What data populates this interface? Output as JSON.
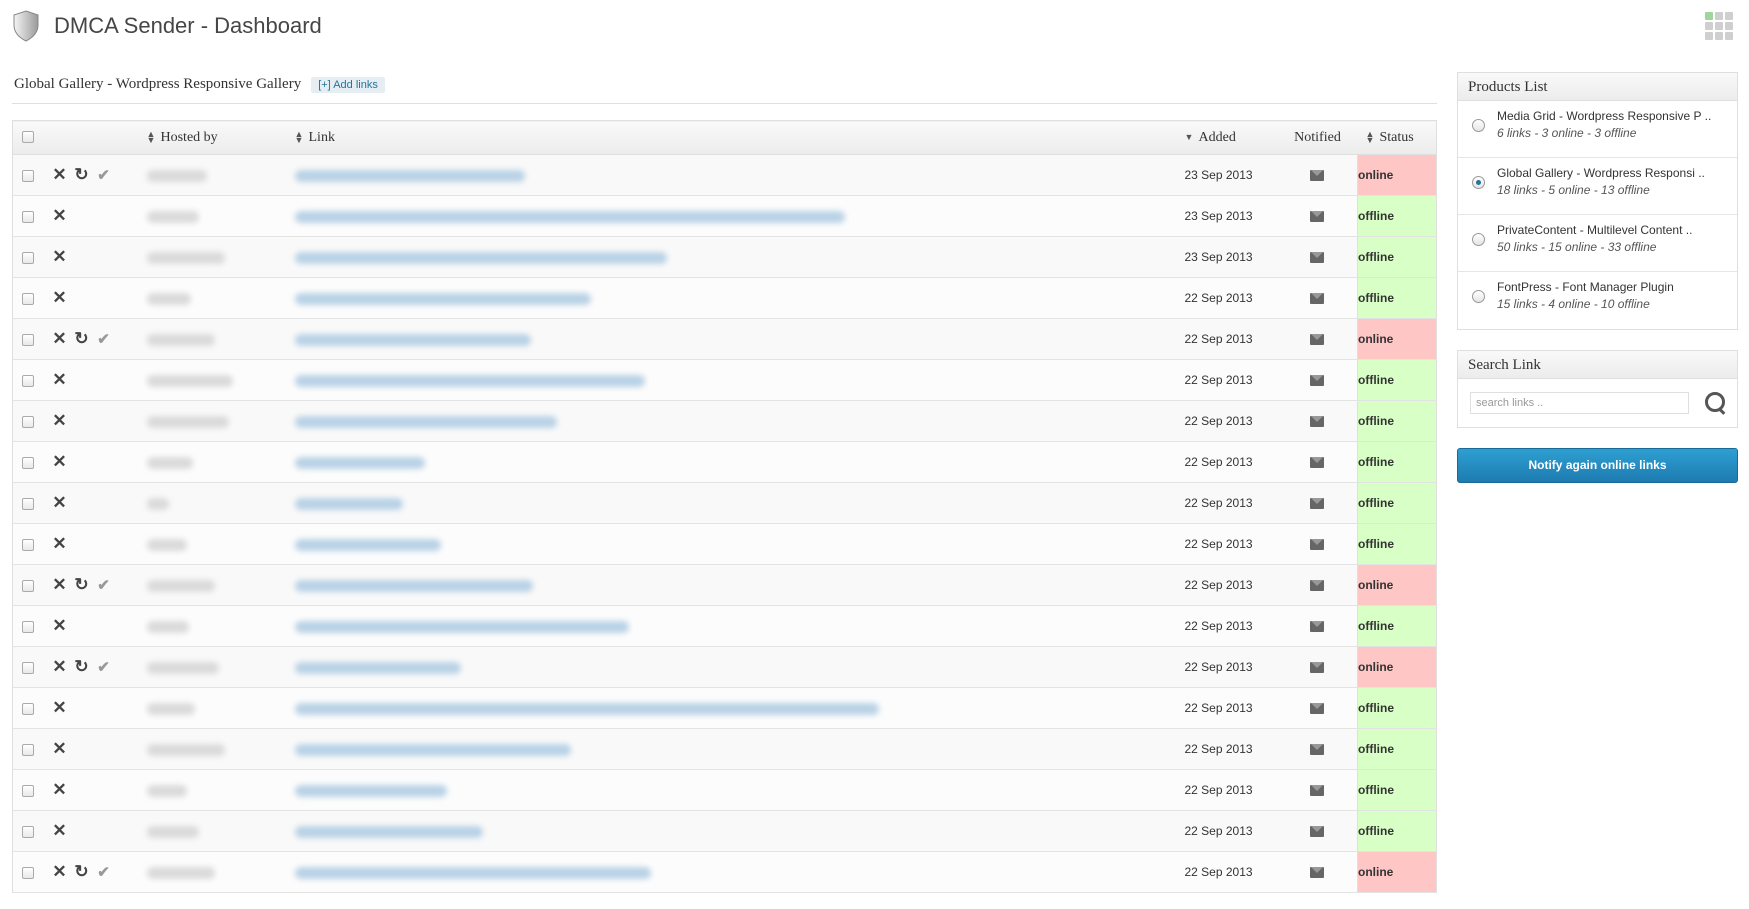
{
  "header": {
    "title": "DMCA Sender - Dashboard"
  },
  "gallery": {
    "title": "Global Gallery - Wordpress Responsive Gallery",
    "add_links_label": "[+] Add links"
  },
  "table": {
    "columns": {
      "hosted_by": "Hosted by",
      "link": "Link",
      "added": "Added",
      "notified": "Notified",
      "status": "Status"
    },
    "rows": [
      {
        "added": "23 Sep 2013",
        "status": "online"
      },
      {
        "added": "23 Sep 2013",
        "status": "offline"
      },
      {
        "added": "23 Sep 2013",
        "status": "offline"
      },
      {
        "added": "22 Sep 2013",
        "status": "offline"
      },
      {
        "added": "22 Sep 2013",
        "status": "online"
      },
      {
        "added": "22 Sep 2013",
        "status": "offline"
      },
      {
        "added": "22 Sep 2013",
        "status": "offline"
      },
      {
        "added": "22 Sep 2013",
        "status": "offline"
      },
      {
        "added": "22 Sep 2013",
        "status": "offline"
      },
      {
        "added": "22 Sep 2013",
        "status": "offline"
      },
      {
        "added": "22 Sep 2013",
        "status": "online"
      },
      {
        "added": "22 Sep 2013",
        "status": "offline"
      },
      {
        "added": "22 Sep 2013",
        "status": "online"
      },
      {
        "added": "22 Sep 2013",
        "status": "offline"
      },
      {
        "added": "22 Sep 2013",
        "status": "offline"
      },
      {
        "added": "22 Sep 2013",
        "status": "offline"
      },
      {
        "added": "22 Sep 2013",
        "status": "offline"
      },
      {
        "added": "22 Sep 2013",
        "status": "online"
      }
    ]
  },
  "sidebar": {
    "products_title": "Products List",
    "products": [
      {
        "name": "Media Grid - Wordpress Responsive P ..",
        "stats": "6 links - 3 online - 3 offline",
        "selected": false
      },
      {
        "name": "Global Gallery - Wordpress Responsi ..",
        "stats": "18 links - 5 online - 13 offline",
        "selected": true
      },
      {
        "name": "PrivateContent - Multilevel Content ..",
        "stats": "50 links - 15 online - 33 offline",
        "selected": false
      },
      {
        "name": "FontPress - Font Manager Plugin",
        "stats": "15 links - 4 online - 10 offline",
        "selected": false
      }
    ],
    "search_title": "Search Link",
    "search_placeholder": "search links ..",
    "notify_button": "Notify again online links"
  },
  "colors": {
    "online_bg": "#ffc6c6",
    "offline_bg": "#d8ffc6",
    "accent": "#21759b"
  }
}
